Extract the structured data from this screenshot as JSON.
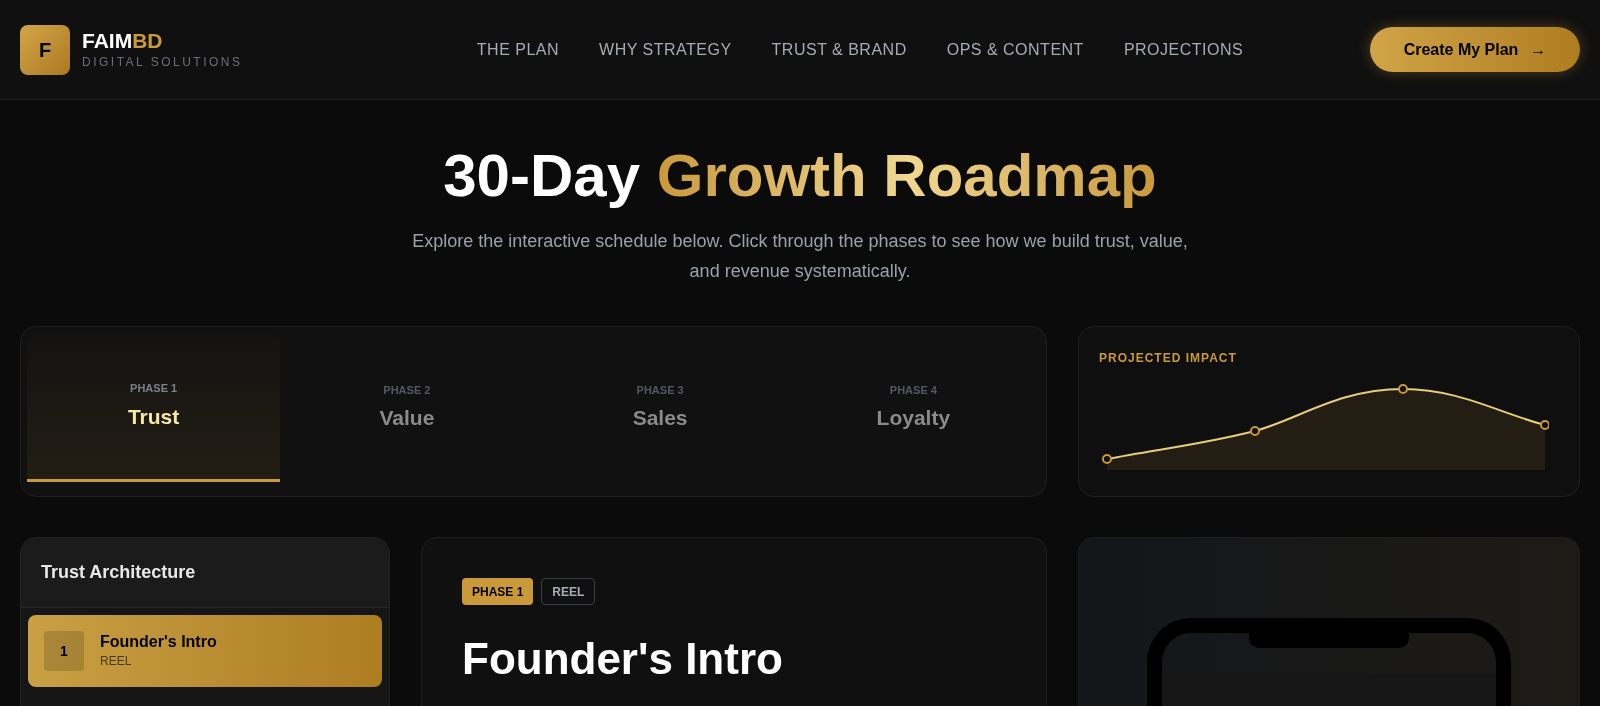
{
  "header": {
    "logo_letter": "F",
    "brand_main": "FAIM",
    "brand_accent": "BD",
    "tagline": "DIGITAL SOLUTIONS",
    "nav": [
      "THE PLAN",
      "WHY STRATEGY",
      "TRUST & BRAND",
      "OPS & CONTENT",
      "PROJECTIONS"
    ],
    "cta": "Create My Plan",
    "cta_arrow": "→"
  },
  "hero": {
    "title_plain": "30-Day",
    "title_accent": "Growth Roadmap",
    "subtitle": "Explore the interactive schedule below. Click through the phases to see how we build trust, value, and revenue systematically."
  },
  "phases": [
    {
      "label": "PHASE 1",
      "name": "Trust",
      "selected": true
    },
    {
      "label": "PHASE 2",
      "name": "Value",
      "selected": false
    },
    {
      "label": "PHASE 3",
      "name": "Sales",
      "selected": false
    },
    {
      "label": "PHASE 4",
      "name": "Loyalty",
      "selected": false
    }
  ],
  "impact": {
    "title": "PROJECTED IMPACT"
  },
  "sidebar": {
    "title": "Trust Architecture",
    "items": [
      {
        "number": "1",
        "title": "Founder's Intro",
        "type": "REEL",
        "selected": true
      }
    ]
  },
  "detail": {
    "tags": [
      {
        "text": "PHASE 1",
        "kind": "filled"
      },
      {
        "text": "REEL",
        "kind": "outline"
      }
    ],
    "title": "Founder's Intro"
  }
}
